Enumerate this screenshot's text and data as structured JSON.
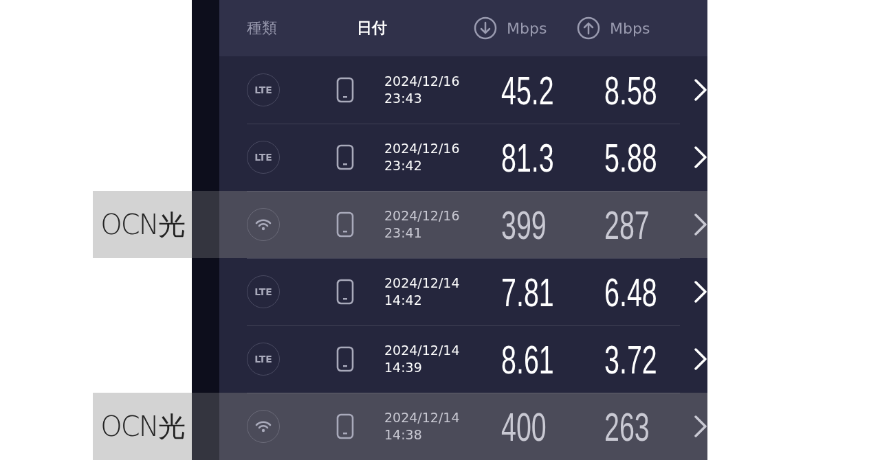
{
  "header": {
    "type_label": "種類",
    "date_label": "日付",
    "download_unit": "Mbps",
    "upload_unit": "Mbps"
  },
  "rows": [
    {
      "kind": "lte",
      "badge": "LTE",
      "date": "2024/12/16",
      "time": "23:43",
      "download": "45.2",
      "upload": "8.58",
      "highlighted": false
    },
    {
      "kind": "lte",
      "badge": "LTE",
      "date": "2024/12/16",
      "time": "23:42",
      "download": "81.3",
      "upload": "5.88",
      "highlighted": false
    },
    {
      "kind": "wifi",
      "date": "2024/12/16",
      "time": "23:41",
      "download": "399",
      "upload": "287",
      "highlighted": true,
      "note": "OCN光"
    },
    {
      "kind": "lte",
      "badge": "LTE",
      "date": "2024/12/14",
      "time": "14:42",
      "download": "7.81",
      "upload": "6.48",
      "highlighted": false
    },
    {
      "kind": "lte",
      "badge": "LTE",
      "date": "2024/12/14",
      "time": "14:39",
      "download": "8.61",
      "upload": "3.72",
      "highlighted": false
    },
    {
      "kind": "wifi",
      "date": "2024/12/14",
      "time": "14:38",
      "download": "400",
      "upload": "263",
      "highlighted": true,
      "note": "OCN光"
    }
  ]
}
